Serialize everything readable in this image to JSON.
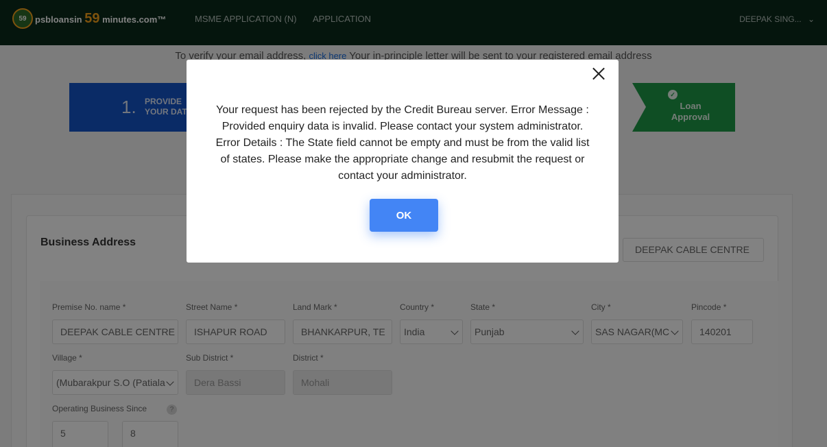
{
  "topbar": {
    "logo_badge": "59",
    "logo_prefix": "psbloansin",
    "logo_number": "59",
    "logo_suffix": "minutes.com™",
    "nav_items": [
      "MSME APPLICATION (N)",
      "APPLICATION"
    ],
    "user_name": "DEEPAK SING...",
    "nav_chevron": "⌄"
  },
  "verify": {
    "prefix": "To verify your email address,",
    "link": "click here",
    "suffix": "Your in-principle letter will be sent to your registered email address"
  },
  "steps": {
    "first_number": "1.",
    "first_label_line1": "PROVIDE",
    "first_label_line2": "YOUR DATA",
    "final_label_line1": "Loan",
    "final_label_line2": "Approval",
    "final_check": "✓"
  },
  "form": {
    "section_title": "Business Address",
    "business_name": "DEEPAK CABLE CENTRE",
    "fields": {
      "premise": {
        "label": "Premise No. name *",
        "value": "DEEPAK CABLE CENTRE"
      },
      "street": {
        "label": "Street Name *",
        "value": "ISHAPUR ROAD"
      },
      "landmark": {
        "label": "Land Mark *",
        "value": "BHANKARPUR, TE"
      },
      "country": {
        "label": "Country *",
        "value": "India"
      },
      "state": {
        "label": "State *",
        "value": "Punjab"
      },
      "city": {
        "label": "City *",
        "value": "SAS NAGAR(MC"
      },
      "pincode": {
        "label": "Pincode *",
        "value": "140201"
      },
      "village": {
        "label": "Village *",
        "value": "(Mubarakpur S.O (Patiala"
      },
      "subdistrict": {
        "label": "Sub District *",
        "value": "Dera Bassi"
      },
      "district": {
        "label": "District *",
        "value": "Mohali"
      },
      "since": {
        "label": "Operating Business Since",
        "years": "5",
        "months": "8",
        "help": "?"
      }
    }
  },
  "modal": {
    "message": "Your request has been rejected by the Credit Bureau server. Error Message : Provided enquiry data is invalid. Please contact your system administrator. Error Details : The State field cannot be empty and must be from the valid list of states. Please make the appropriate change and resubmit the request or contact your administrator.",
    "ok_label": "OK"
  },
  "colors": {
    "topbar": "#0a2a1b",
    "step_active": "#1455c8",
    "step_final": "#1f9a47",
    "ok_button": "#4385f5"
  }
}
